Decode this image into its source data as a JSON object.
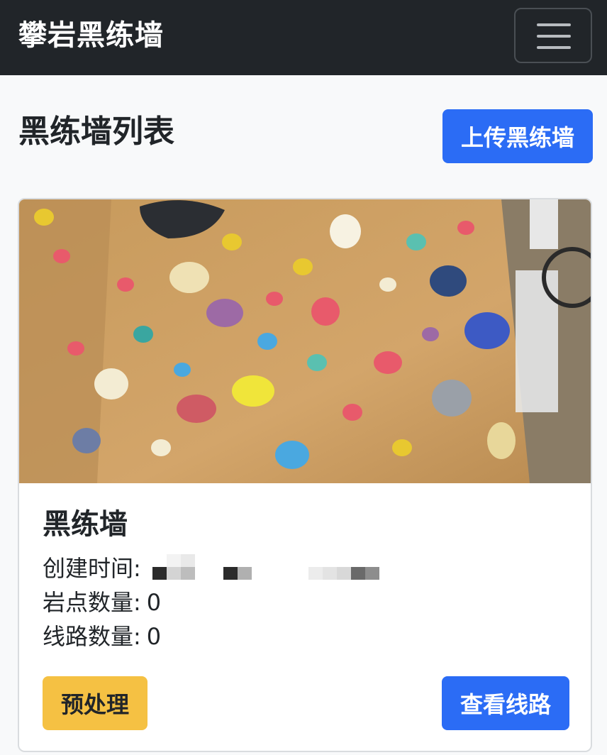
{
  "navbar": {
    "brand": "攀岩黑练墙",
    "menu_icon": "hamburger-menu-icon"
  },
  "header": {
    "title": "黑练墙列表",
    "upload_label": "上传黑练墙"
  },
  "card": {
    "image_alt": "climbing wall photo",
    "title": "黑练墙",
    "created_label": "创建时间:",
    "holds_label": "岩点数量:",
    "holds_value": "0",
    "routes_label": "线路数量:",
    "routes_value": "0",
    "preprocess_label": "预处理",
    "view_routes_label": "查看线路"
  },
  "colors": {
    "navbar_bg": "#212529",
    "primary": "#2b6cf5",
    "warning": "#f5c143",
    "page_bg": "#f8f9fa"
  }
}
